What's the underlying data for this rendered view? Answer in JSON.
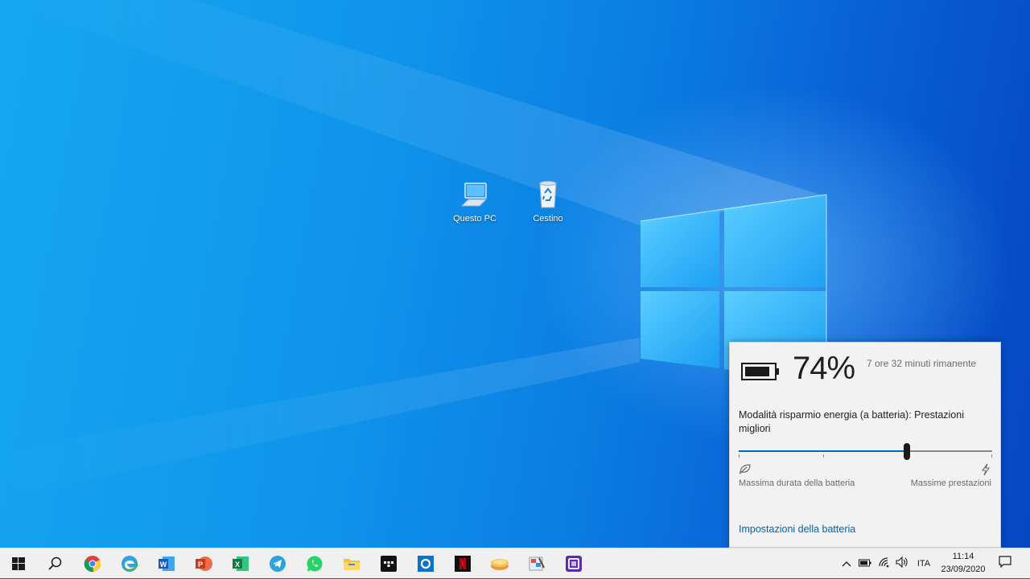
{
  "desktop": {
    "icons": [
      {
        "label": "Questo PC",
        "icon": "computer-icon"
      },
      {
        "label": "Cestino",
        "icon": "recycle-bin-icon"
      }
    ]
  },
  "battery_flyout": {
    "percent": "74%",
    "time_remaining": "7 ore 32 minuti rimanente",
    "power_mode_label": "Modalità risparmio energia (a batteria): Prestazioni migliori",
    "slider_value": 0.66,
    "left_label": "Massima durata della batteria",
    "right_label": "Massime prestazioni",
    "settings_link": "Impostazioni della batteria",
    "accent_color": "#0067c0"
  },
  "taskbar": {
    "apps": [
      "start-icon",
      "search-icon",
      "chrome-icon",
      "edge-icon",
      "word-icon",
      "powerpoint-icon",
      "excel-icon",
      "telegram-icon",
      "whatsapp-icon",
      "file-explorer-icon",
      "tidal-icon",
      "outlook-icon",
      "netflix-icon",
      "store-icon",
      "paint-icon",
      "app-icon"
    ],
    "tray": {
      "language": "ITA",
      "time": "11:14",
      "date": "23/09/2020"
    }
  }
}
